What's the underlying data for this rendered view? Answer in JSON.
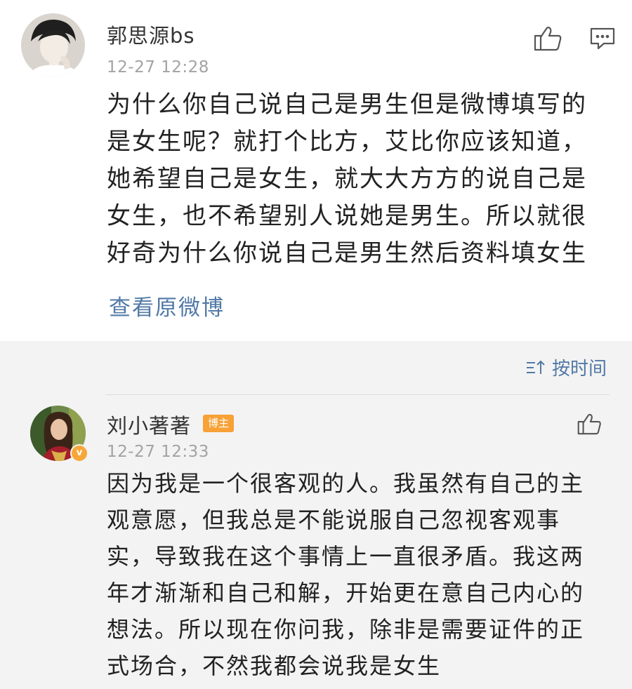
{
  "comment": {
    "username": "郭思源bs",
    "time": "12-27 12:28",
    "lines": [
      "为什么你自己说自己是男生但是微博填写的",
      "是女生呢？就打个比方，艾比你应该知道，",
      "她希望自己是女生，就大大方方的说自己是",
      "女生，也不希望别人说她是男生。所以就很",
      "好奇为什么你说自己是男生然后资料填女生"
    ],
    "view_original": "查看原微博"
  },
  "sort": {
    "label": "按时间"
  },
  "reply": {
    "username": "刘小著著",
    "badge": "博主",
    "verified_mark": "v",
    "time": "12-27 12:33",
    "lines": [
      "因为我是一个很客观的人。我虽然有自己的主",
      "观意愿，但我总是不能说服自己忽视客观事",
      "实，导致我在这个事情上一直很矛盾。我这两",
      "年才渐渐和自己和解，开始更在意自己内心的",
      "想法。所以现在你问我，除非是需要证件的正",
      "式场合，不然我都会说我是女生"
    ]
  },
  "icons": {
    "like": "thumbs-up-icon",
    "comment": "comment-icon",
    "sort": "sort-icon",
    "verified": "verified-badge-icon"
  },
  "colors": {
    "link": "#5179a6",
    "badge": "#f7a136",
    "background_gray": "#f3f3f3"
  }
}
